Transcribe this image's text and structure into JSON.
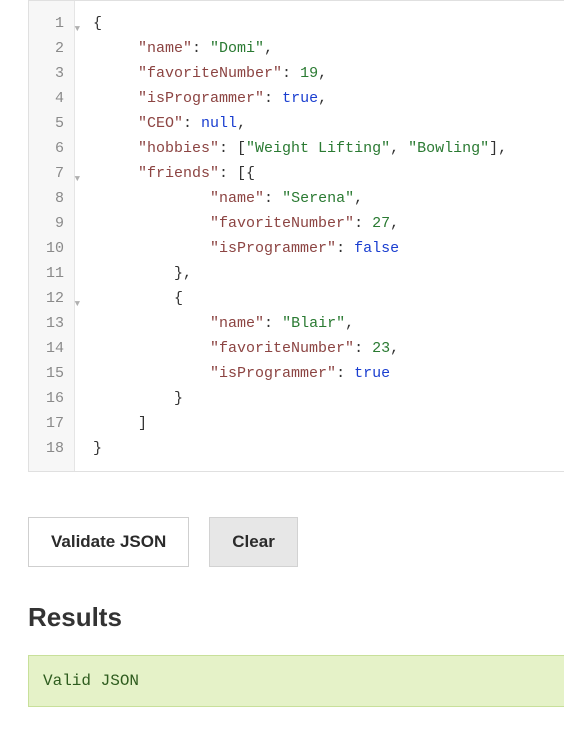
{
  "editor": {
    "lines": [
      {
        "n": 1,
        "fold": true,
        "tokens": [
          [
            "p",
            "{"
          ]
        ]
      },
      {
        "n": 2,
        "fold": false,
        "indent": 5,
        "tokens": [
          [
            "key",
            "\"name\""
          ],
          [
            "p",
            ": "
          ],
          [
            "str",
            "\"Domi\""
          ],
          [
            "p",
            ","
          ]
        ]
      },
      {
        "n": 3,
        "fold": false,
        "indent": 5,
        "tokens": [
          [
            "key",
            "\"favoriteNumber\""
          ],
          [
            "p",
            ": "
          ],
          [
            "num",
            "19"
          ],
          [
            "p",
            ","
          ]
        ]
      },
      {
        "n": 4,
        "fold": false,
        "indent": 5,
        "tokens": [
          [
            "key",
            "\"isProgrammer\""
          ],
          [
            "p",
            ": "
          ],
          [
            "bool",
            "true"
          ],
          [
            "p",
            ","
          ]
        ]
      },
      {
        "n": 5,
        "fold": false,
        "indent": 5,
        "tokens": [
          [
            "key",
            "\"CEO\""
          ],
          [
            "p",
            ": "
          ],
          [
            "null",
            "null"
          ],
          [
            "p",
            ","
          ]
        ]
      },
      {
        "n": 6,
        "fold": false,
        "indent": 5,
        "tokens": [
          [
            "key",
            "\"hobbies\""
          ],
          [
            "p",
            ": ["
          ],
          [
            "str",
            "\"Weight Lifting\""
          ],
          [
            "p",
            ", "
          ],
          [
            "str",
            "\"Bowling\""
          ],
          [
            "p",
            "],"
          ]
        ]
      },
      {
        "n": 7,
        "fold": true,
        "indent": 5,
        "tokens": [
          [
            "key",
            "\"friends\""
          ],
          [
            "p",
            ": [{"
          ]
        ]
      },
      {
        "n": 8,
        "fold": false,
        "indent": 13,
        "tokens": [
          [
            "key",
            "\"name\""
          ],
          [
            "p",
            ": "
          ],
          [
            "str",
            "\"Serena\""
          ],
          [
            "p",
            ","
          ]
        ]
      },
      {
        "n": 9,
        "fold": false,
        "indent": 13,
        "tokens": [
          [
            "key",
            "\"favoriteNumber\""
          ],
          [
            "p",
            ": "
          ],
          [
            "num",
            "27"
          ],
          [
            "p",
            ","
          ]
        ]
      },
      {
        "n": 10,
        "fold": false,
        "indent": 13,
        "tokens": [
          [
            "key",
            "\"isProgrammer\""
          ],
          [
            "p",
            ": "
          ],
          [
            "bool",
            "false"
          ]
        ]
      },
      {
        "n": 11,
        "fold": false,
        "indent": 9,
        "tokens": [
          [
            "p",
            "},"
          ]
        ]
      },
      {
        "n": 12,
        "fold": true,
        "indent": 9,
        "tokens": [
          [
            "p",
            "{"
          ]
        ]
      },
      {
        "n": 13,
        "fold": false,
        "indent": 13,
        "tokens": [
          [
            "key",
            "\"name\""
          ],
          [
            "p",
            ": "
          ],
          [
            "str",
            "\"Blair\""
          ],
          [
            "p",
            ","
          ]
        ]
      },
      {
        "n": 14,
        "fold": false,
        "indent": 13,
        "tokens": [
          [
            "key",
            "\"favoriteNumber\""
          ],
          [
            "p",
            ": "
          ],
          [
            "num",
            "23"
          ],
          [
            "p",
            ","
          ]
        ]
      },
      {
        "n": 15,
        "fold": false,
        "indent": 13,
        "tokens": [
          [
            "key",
            "\"isProgrammer\""
          ],
          [
            "p",
            ": "
          ],
          [
            "bool",
            "true"
          ]
        ]
      },
      {
        "n": 16,
        "fold": false,
        "indent": 9,
        "tokens": [
          [
            "p",
            "}"
          ]
        ]
      },
      {
        "n": 17,
        "fold": false,
        "indent": 5,
        "tokens": [
          [
            "p",
            "]"
          ]
        ]
      },
      {
        "n": 18,
        "fold": false,
        "indent": 0,
        "tokens": [
          [
            "p",
            "}"
          ]
        ]
      }
    ]
  },
  "buttons": {
    "validate": "Validate JSON",
    "clear": "Clear"
  },
  "results": {
    "heading": "Results",
    "message": "Valid JSON"
  }
}
